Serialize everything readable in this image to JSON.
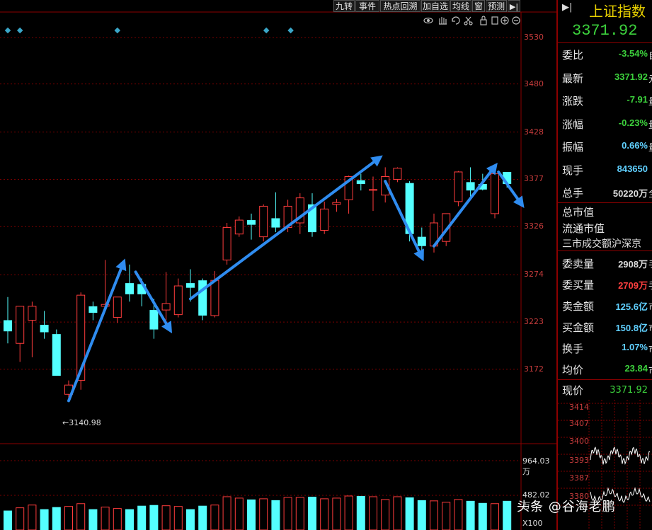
{
  "toolbar": {
    "buttons": [
      "九转",
      "事件",
      "热点回溯",
      "加自选",
      "均线",
      "窗",
      "预测"
    ],
    "pin_icon": "pin-icon"
  },
  "chart_data": {
    "type": "candlestick",
    "y_ticks": [
      "3530",
      "3480",
      "3428",
      "3377",
      "3326",
      "3274",
      "3223",
      "3172"
    ],
    "ylim": [
      3120,
      3540
    ],
    "low_annotation": "3140.98",
    "volume_ticks": [
      "964.03万",
      "482.02万"
    ],
    "volume_unit": "X100",
    "colors": {
      "up": "#ff3c3c",
      "down": "#54ffff",
      "arrow": "#2f8cf0",
      "grid": "#7a0000"
    },
    "candles": [
      {
        "o": 3225,
        "h": 3250,
        "l": 3200,
        "c": 3213
      },
      {
        "o": 3200,
        "h": 3240,
        "l": 3180,
        "c": 3240
      },
      {
        "o": 3225,
        "h": 3245,
        "l": 3185,
        "c": 3240
      },
      {
        "o": 3220,
        "h": 3235,
        "l": 3205,
        "c": 3212
      },
      {
        "o": 3210,
        "h": 3215,
        "l": 3165,
        "c": 3165
      },
      {
        "o": 3145,
        "h": 3160,
        "l": 3141,
        "c": 3155
      },
      {
        "o": 3160,
        "h": 3255,
        "l": 3150,
        "c": 3252
      },
      {
        "o": 3240,
        "h": 3245,
        "l": 3225,
        "c": 3233
      },
      {
        "o": 3240,
        "h": 3290,
        "l": 3235,
        "c": 3242
      },
      {
        "o": 3228,
        "h": 3250,
        "l": 3222,
        "c": 3250
      },
      {
        "o": 3265,
        "h": 3285,
        "l": 3245,
        "c": 3253
      },
      {
        "o": 3264,
        "h": 3270,
        "l": 3240,
        "c": 3253
      },
      {
        "o": 3236,
        "h": 3248,
        "l": 3205,
        "c": 3215
      },
      {
        "o": 3236,
        "h": 3277,
        "l": 3225,
        "c": 3243
      },
      {
        "o": 3231,
        "h": 3270,
        "l": 3228,
        "c": 3262
      },
      {
        "o": 3265,
        "h": 3280,
        "l": 3245,
        "c": 3260
      },
      {
        "o": 3268,
        "h": 3270,
        "l": 3225,
        "c": 3230
      },
      {
        "o": 3230,
        "h": 3278,
        "l": 3228,
        "c": 3268
      },
      {
        "o": 3290,
        "h": 3330,
        "l": 3285,
        "c": 3325
      },
      {
        "o": 3318,
        "h": 3337,
        "l": 3315,
        "c": 3333
      },
      {
        "o": 3333,
        "h": 3340,
        "l": 3312,
        "c": 3328
      },
      {
        "o": 3315,
        "h": 3350,
        "l": 3310,
        "c": 3348
      },
      {
        "o": 3335,
        "h": 3363,
        "l": 3320,
        "c": 3325
      },
      {
        "o": 3325,
        "h": 3355,
        "l": 3320,
        "c": 3348
      },
      {
        "o": 3330,
        "h": 3362,
        "l": 3318,
        "c": 3357
      },
      {
        "o": 3350,
        "h": 3362,
        "l": 3315,
        "c": 3320
      },
      {
        "o": 3322,
        "h": 3353,
        "l": 3318,
        "c": 3345
      },
      {
        "o": 3350,
        "h": 3356,
        "l": 3342,
        "c": 3352
      },
      {
        "o": 3355,
        "h": 3381,
        "l": 3340,
        "c": 3380
      },
      {
        "o": 3376,
        "h": 3383,
        "l": 3365,
        "c": 3372
      },
      {
        "o": 3366,
        "h": 3380,
        "l": 3343,
        "c": 3366
      },
      {
        "o": 3360,
        "h": 3390,
        "l": 3352,
        "c": 3380
      },
      {
        "o": 3377,
        "h": 3390,
        "l": 3374,
        "c": 3389
      },
      {
        "o": 3373,
        "h": 3375,
        "l": 3310,
        "c": 3318
      },
      {
        "o": 3315,
        "h": 3325,
        "l": 3300,
        "c": 3305
      },
      {
        "o": 3305,
        "h": 3340,
        "l": 3298,
        "c": 3330
      },
      {
        "o": 3310,
        "h": 3340,
        "l": 3305,
        "c": 3340
      },
      {
        "o": 3353,
        "h": 3386,
        "l": 3348,
        "c": 3385
      },
      {
        "o": 3374,
        "h": 3390,
        "l": 3355,
        "c": 3365
      },
      {
        "o": 3372,
        "h": 3383,
        "l": 3365,
        "c": 3366
      },
      {
        "o": 3340,
        "h": 3385,
        "l": 3335,
        "c": 3383
      },
      {
        "o": 3385,
        "h": 3385,
        "l": 3368,
        "c": 3372
      }
    ],
    "volumes": [
      0.28,
      0.32,
      0.36,
      0.3,
      0.33,
      0.34,
      0.38,
      0.3,
      0.33,
      0.31,
      0.3,
      0.35,
      0.36,
      0.35,
      0.34,
      0.3,
      0.35,
      0.36,
      0.48,
      0.46,
      0.44,
      0.45,
      0.43,
      0.47,
      0.47,
      0.48,
      0.45,
      0.46,
      0.49,
      0.49,
      0.48,
      0.44,
      0.48,
      0.47,
      0.43,
      0.42,
      0.4,
      0.44,
      0.42,
      0.39,
      0.38,
      0.42
    ],
    "event_markers": [
      0,
      1,
      9,
      16,
      18
    ]
  },
  "panel": {
    "title": "上证指数",
    "price": "3371.92",
    "rows": [
      {
        "label": "委比",
        "value": "-3.54%",
        "color": "green"
      },
      {
        "label": "最新",
        "value": "3371.92",
        "color": "green"
      },
      {
        "label": "涨跌",
        "value": "-7.91",
        "color": "green"
      },
      {
        "label": "涨幅",
        "value": "-0.23%",
        "color": "green"
      },
      {
        "label": "振幅",
        "value": "0.66%",
        "color": "cyan"
      },
      {
        "label": "现手",
        "value": "843650",
        "color": "cyan"
      },
      {
        "label": "总手",
        "value": "50220万",
        "color": "white"
      }
    ],
    "rows_edge": [
      "自",
      "元",
      "量",
      "量",
      "量",
      "",
      "全"
    ],
    "text_rows": [
      "总市值",
      "流通市值",
      "三市成交额沪深京"
    ],
    "rows2": [
      {
        "label": "委卖量",
        "value": "2908万",
        "color": "white"
      },
      {
        "label": "委买量",
        "value": "2709万",
        "color": "red"
      },
      {
        "label": "卖金额",
        "value": "125.6亿",
        "color": "cyan"
      },
      {
        "label": "买金额",
        "value": "150.8亿",
        "color": "cyan"
      },
      {
        "label": "换手",
        "value": "1.07%",
        "color": "cyan"
      },
      {
        "label": "均价",
        "value": "23.84",
        "color": "green"
      }
    ],
    "rows2_edge": [
      "手",
      "手",
      "市",
      "市",
      "市",
      "市"
    ],
    "now_price_label": "现价",
    "now_price_value": "3371.92",
    "mini_ticks": [
      "3414",
      "3407",
      "3400",
      "3393",
      "3387",
      "3380"
    ]
  },
  "watermark": "头条 @谷海老鹏"
}
